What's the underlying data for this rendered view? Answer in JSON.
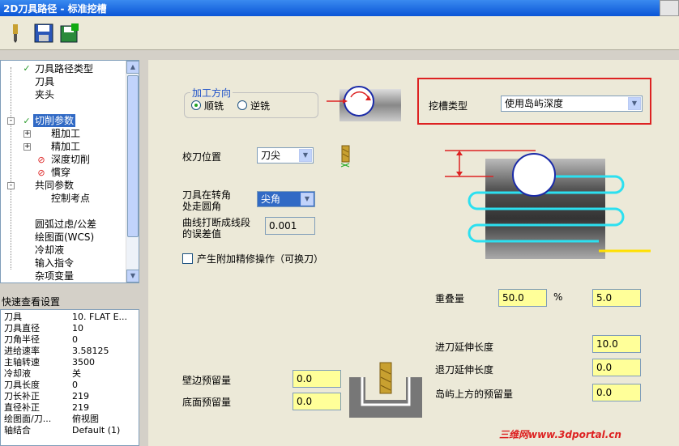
{
  "window": {
    "title": "2D刀具路径 - 标准挖槽"
  },
  "tree": {
    "items": [
      {
        "label": "刀具路径类型",
        "mark": "check"
      },
      {
        "label": "刀具",
        "mark": ""
      },
      {
        "label": "夹头",
        "mark": ""
      },
      {
        "label": "切削参数",
        "mark": "check",
        "selected": true
      },
      {
        "label": "粗加工",
        "mark": ""
      },
      {
        "label": "精加工",
        "mark": ""
      },
      {
        "label": "深度切削",
        "mark": "forbid"
      },
      {
        "label": "慣穿",
        "mark": "forbid"
      },
      {
        "label": "共同参数",
        "mark": ""
      },
      {
        "label": "控制考点",
        "mark": ""
      },
      {
        "label": "圆弧过虑/公差",
        "mark": ""
      },
      {
        "label": "绘图面(WCS)",
        "mark": ""
      },
      {
        "label": "冷却液",
        "mark": ""
      },
      {
        "label": "输入指令",
        "mark": ""
      },
      {
        "label": "杂项变量",
        "mark": ""
      }
    ]
  },
  "quick_view": {
    "title": "快速查看设置",
    "rows": [
      {
        "k": "刀具",
        "v": "10. FLAT E..."
      },
      {
        "k": "刀具直径",
        "v": "10"
      },
      {
        "k": "刀角半径",
        "v": "0"
      },
      {
        "k": "进给速率",
        "v": "3.58125"
      },
      {
        "k": "主轴转速",
        "v": "3500"
      },
      {
        "k": "冷却液",
        "v": "关"
      },
      {
        "k": "刀具长度",
        "v": "0"
      },
      {
        "k": "刀长补正",
        "v": "219"
      },
      {
        "k": "直径补正",
        "v": "219"
      },
      {
        "k": "绘图面/刀...",
        "v": "俯视图"
      },
      {
        "k": "轴结合",
        "v": "Default (1)"
      }
    ]
  },
  "params": {
    "direction_group": "加工方向",
    "climb": "顺铣",
    "conventional": "逆铣",
    "pocket_type_label": "挖槽类型",
    "pocket_type_value": "使用岛屿深度",
    "tool_pos_label": "校刀位置",
    "tool_pos_value": "刀尖",
    "corner_label_1": "刀具在转角",
    "corner_label_2": "处走圆角",
    "corner_value": "尖角",
    "linear_label_1": "曲线打断成线段",
    "linear_label_2": "的误差值",
    "linear_value": "0.001",
    "finish_checkbox": "产生附加精修操作（可换刀）",
    "overlap_label": "重叠量",
    "overlap_pct": "50.0",
    "pct_sign": "%",
    "overlap_val": "5.0",
    "entry_ext_label": "进刀延伸长度",
    "entry_ext": "10.0",
    "exit_ext_label": "退刀延伸长度",
    "exit_ext": "0.0",
    "island_stock_label": "岛屿上方的预留量",
    "island_stock": "0.0",
    "wall_stock_label": "壁边预留量",
    "wall_stock": "0.0",
    "floor_stock_label": "底面预留量",
    "floor_stock": "0.0"
  },
  "watermark": "三维网www.3dportal.cn"
}
